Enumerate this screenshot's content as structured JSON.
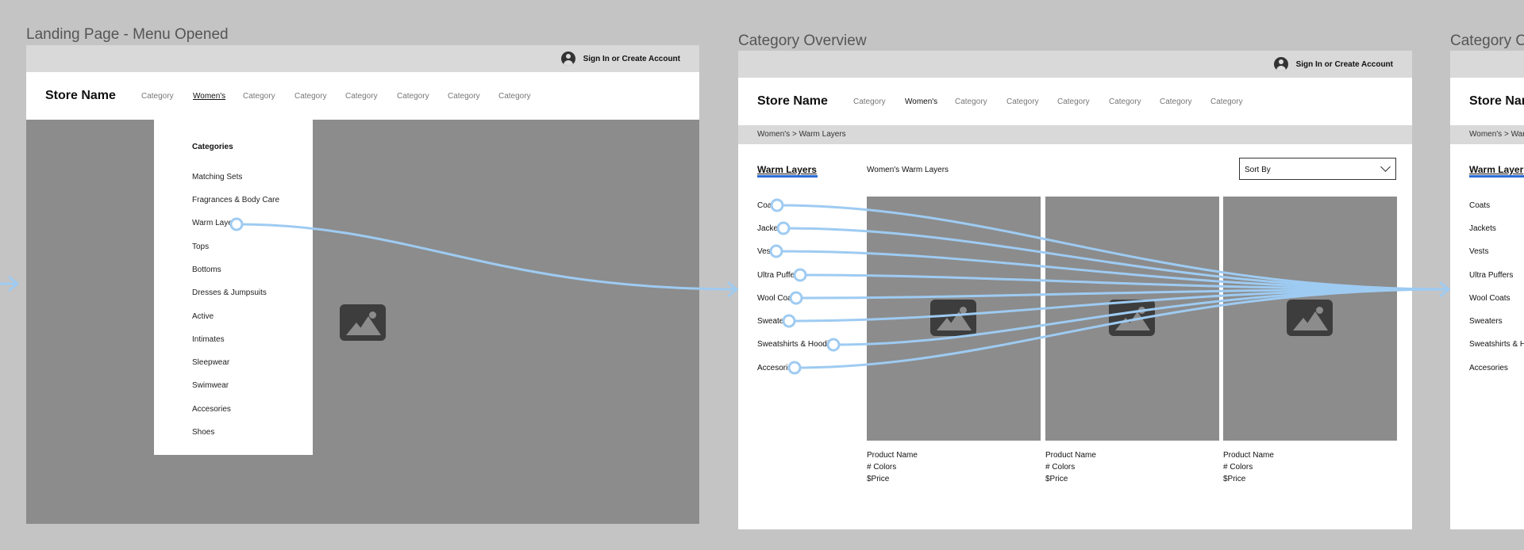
{
  "frames": [
    {
      "title": "Landing Page - Menu Opened",
      "signin": "Sign In or Create Account",
      "store_name": "Store Name",
      "nav": [
        "Category",
        "Women's",
        "Category",
        "Category",
        "Category",
        "Category",
        "Category",
        "Category"
      ],
      "menu": {
        "title": "Categories",
        "items": [
          "Matching Sets",
          "Fragrances & Body Care",
          "Warm Laye",
          "Tops",
          "Bottoms",
          "Dresses & Jumpsuits",
          "Active",
          "Intimates",
          "Sleepwear",
          "Swimwear",
          "Accesories",
          "Shoes"
        ]
      }
    },
    {
      "title": "Category Overview",
      "signin": "Sign In or Create Account",
      "store_name": "Store Name",
      "nav": [
        "Category",
        "Women's",
        "Category",
        "Category",
        "Category",
        "Category",
        "Category",
        "Category"
      ],
      "breadcrumb": "Women's > Warm Layers",
      "heading": "Warm Layers",
      "subheading": "Women's Warm Layers",
      "sort_label": "Sort By",
      "filters": [
        "Coa",
        "Jacke",
        "Ves",
        "Ultra Puffe",
        "Wool Coa",
        "Sweate",
        "Sweatshirts & Hoodi",
        "Accesori"
      ],
      "products": [
        {
          "name": "Product Name",
          "colors": "# Colors",
          "price": "$Price"
        },
        {
          "name": "Product Name",
          "colors": "# Colors",
          "price": "$Price"
        },
        {
          "name": "Product Name",
          "colors": "# Colors",
          "price": "$Price"
        }
      ]
    },
    {
      "title": "Category O",
      "store_name": "Store Nar",
      "breadcrumb": "Women's > Warr",
      "heading": "Warm Layer",
      "filters": [
        "Coats",
        "Jackets",
        "Vests",
        "Ultra Puffers",
        "Wool Coats",
        "Sweaters",
        "Sweatshirts & H",
        "Accesories"
      ]
    }
  ],
  "colors": {
    "canvas": "#c4c4c4",
    "gray_bar": "#d9d9d9",
    "placeholder": "#8c8c8c",
    "connector": "#9ecbf2",
    "heading_underline": "#2b6cd6"
  }
}
